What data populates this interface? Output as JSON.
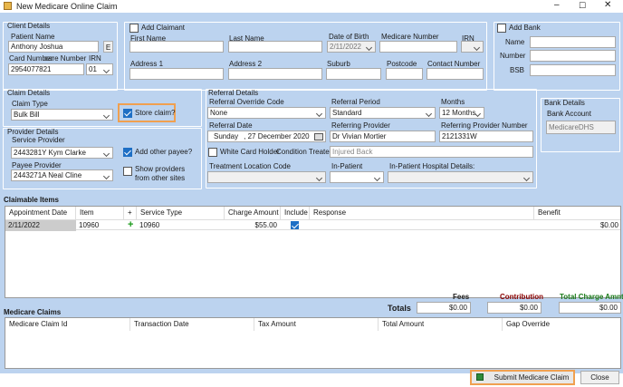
{
  "window": {
    "title": "New Medicare Online Claim",
    "minimize": "–",
    "maximize": "☐",
    "close": "✕"
  },
  "client": {
    "group": "Client Details",
    "patient_name_label": "Patient Name",
    "patient_name": "Anthony Joshua",
    "e_button": "E",
    "card_number_label": "Card Number",
    "card_suffix_label": "care Number",
    "irn_label": "IRN",
    "card_number": "2954077821",
    "irn": "01",
    "add_claimant": "Add Claimant",
    "first_name_label": "First Name",
    "last_name_label": "Last Name",
    "dob_label": "Date of Birth",
    "dob": "2/11/2022",
    "medicare_number_label": "Medicare Number",
    "irn2_label": "IRN",
    "address1_label": "Address 1",
    "address2_label": "Address 2",
    "suburb_label": "Suburb",
    "postcode_label": "Postcode",
    "contact_number_label": "Contact Number"
  },
  "bank": {
    "add_bank": "Add Bank",
    "name_label": "Name",
    "number_label": "Number",
    "bsb_label": "BSB",
    "details_group": "Bank Details",
    "account_label": "Bank Account",
    "account": "MedicareDHS"
  },
  "claim": {
    "group": "Claim Details",
    "type_label": "Claim Type",
    "type": "Bulk Bill",
    "store_claim": "Store claim?"
  },
  "provider": {
    "group": "Provider Details",
    "service_provider_label": "Service Provider",
    "service_provider": "2443281Y Kym Clarke",
    "add_other_payee": "Add other payee?",
    "payee_label": "Payee Provider",
    "payee": "2443271A Neal Cline",
    "show_other_sites": "Show providers from other sites"
  },
  "referral": {
    "group": "Referral Details",
    "override_label": "Referral Override Code",
    "override": "None",
    "period_label": "Referral Period",
    "period": "Standard",
    "months_label": "Months",
    "months": "12 Months",
    "date_label": "Referral Date",
    "date_day": "Sunday",
    "date": ", 27 December 2020",
    "referring_provider_label": "Referring Provider",
    "referring_provider": "Dr Vivian Mortier",
    "referring_number_label": "Referring Provider Number",
    "referring_number": "2121331W",
    "white_card": "White Card Holder",
    "condition_treated": "Condition Treated",
    "injured_placeholder": "Injured Back",
    "treatment_location_label": "Treatment Location Code",
    "in_patient_label": "In-Patient",
    "hospital_label": "In-Patient Hospital Details:"
  },
  "claimable": {
    "title": "Claimable Items",
    "headers": [
      "Appointment Date",
      "Item",
      "+",
      "Service Type",
      "Charge Amount",
      "Include",
      "Response",
      "Benefit"
    ],
    "row": {
      "date": "2/11/2022",
      "item": "10960",
      "service_type": "10960",
      "charge": "$55.00",
      "benefit": "$0.00"
    }
  },
  "totals": {
    "fees_label": "Fees",
    "contribution_label": "Contribution",
    "total_charge_label": "Total Charge Amnt",
    "totals_label": "Totals",
    "fees": "$0.00",
    "contribution": "$0.00",
    "total_charge": "$0.00",
    "colors": {
      "contribution": "#8b0000",
      "total_charge": "#1a7a1a"
    }
  },
  "medicare_claims": {
    "title": "Medicare Claims",
    "headers": [
      "Medicare Claim Id",
      "Transaction Date",
      "Tax Amount",
      "Total Amount",
      "Gap Override"
    ]
  },
  "actions": {
    "submit": "Submit Medicare Claim",
    "close": "Close"
  }
}
